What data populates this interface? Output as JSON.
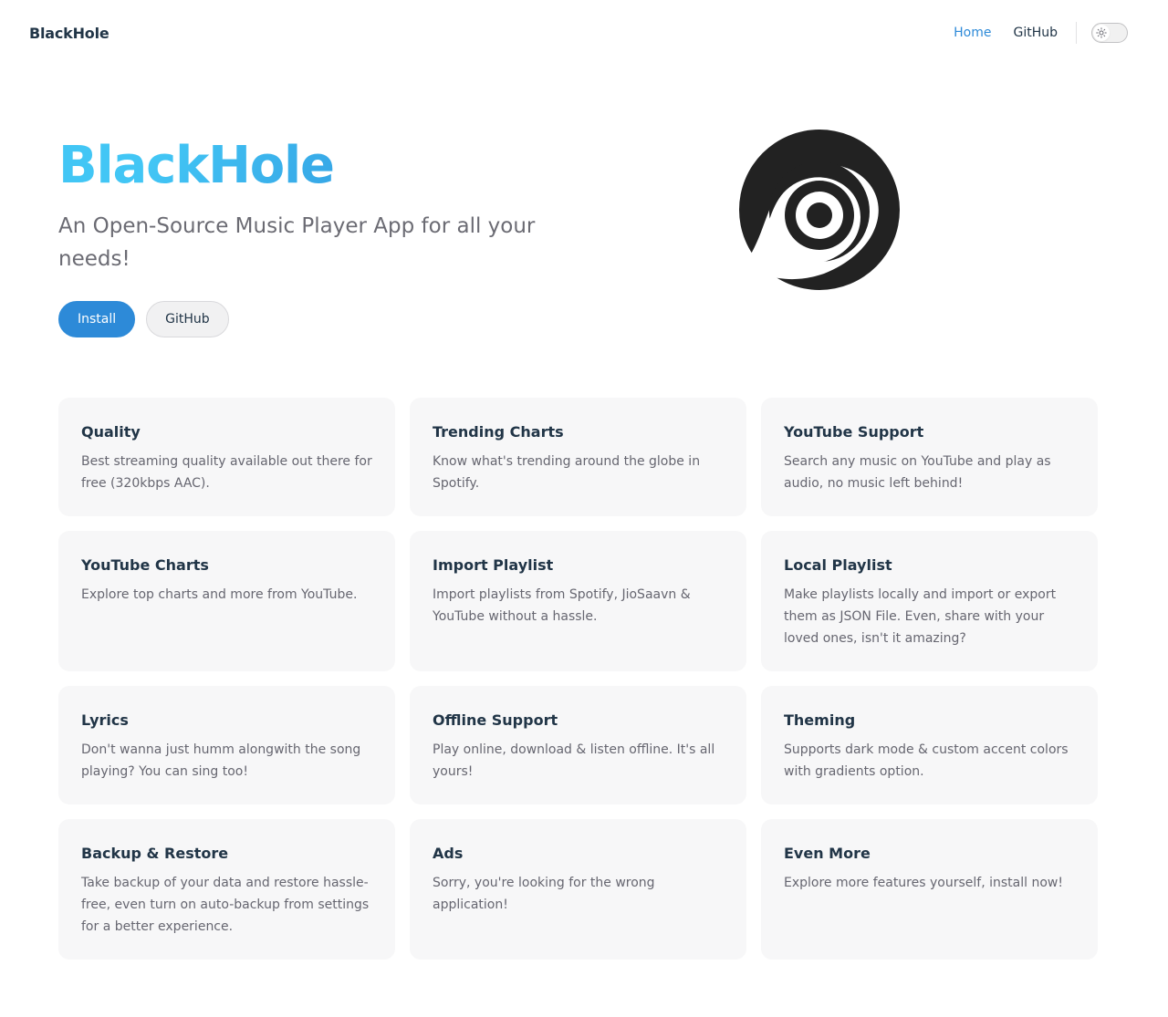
{
  "nav": {
    "brand": "BlackHole",
    "links": [
      {
        "label": "Home",
        "active": true
      },
      {
        "label": "GitHub",
        "active": false
      }
    ],
    "theme_toggle_icon": "sun-icon"
  },
  "hero": {
    "title": "BlackHole",
    "tagline": "An Open-Source Music Player App for all your needs!",
    "primary_action": "Install",
    "secondary_action": "GitHub",
    "logo_icon": "blackhole-logo-icon"
  },
  "colors": {
    "accent": "#2d8ad8",
    "gradient_start": "#42c6f5",
    "gradient_end": "#2b89d8",
    "card_bg": "#f7f7f8"
  },
  "features": [
    {
      "title": "Quality",
      "desc": "Best streaming quality available out there for free (320kbps AAC)."
    },
    {
      "title": "Trending Charts",
      "desc": "Know what's trending around the globe in Spotify."
    },
    {
      "title": "YouTube Support",
      "desc": "Search any music on YouTube and play as audio, no music left behind!"
    },
    {
      "title": "YouTube Charts",
      "desc": "Explore top charts and more from YouTube."
    },
    {
      "title": "Import Playlist",
      "desc": "Import playlists from Spotify, JioSaavn & YouTube without a hassle."
    },
    {
      "title": "Local Playlist",
      "desc": "Make playlists locally and import or export them as JSON File. Even, share with your loved ones, isn't it amazing?"
    },
    {
      "title": "Lyrics",
      "desc": "Don't wanna just humm alongwith the song playing? You can sing too!"
    },
    {
      "title": "Offline Support",
      "desc": "Play online, download & listen offline. It's all yours!"
    },
    {
      "title": "Theming",
      "desc": "Supports dark mode & custom accent colors with gradients option."
    },
    {
      "title": "Backup & Restore",
      "desc": "Take backup of your data and restore hassle-free, even turn on auto-backup from settings for a better experience."
    },
    {
      "title": "Ads",
      "desc": "Sorry, you're looking for the wrong application!"
    },
    {
      "title": "Even More",
      "desc": "Explore more features yourself, install now!"
    }
  ]
}
